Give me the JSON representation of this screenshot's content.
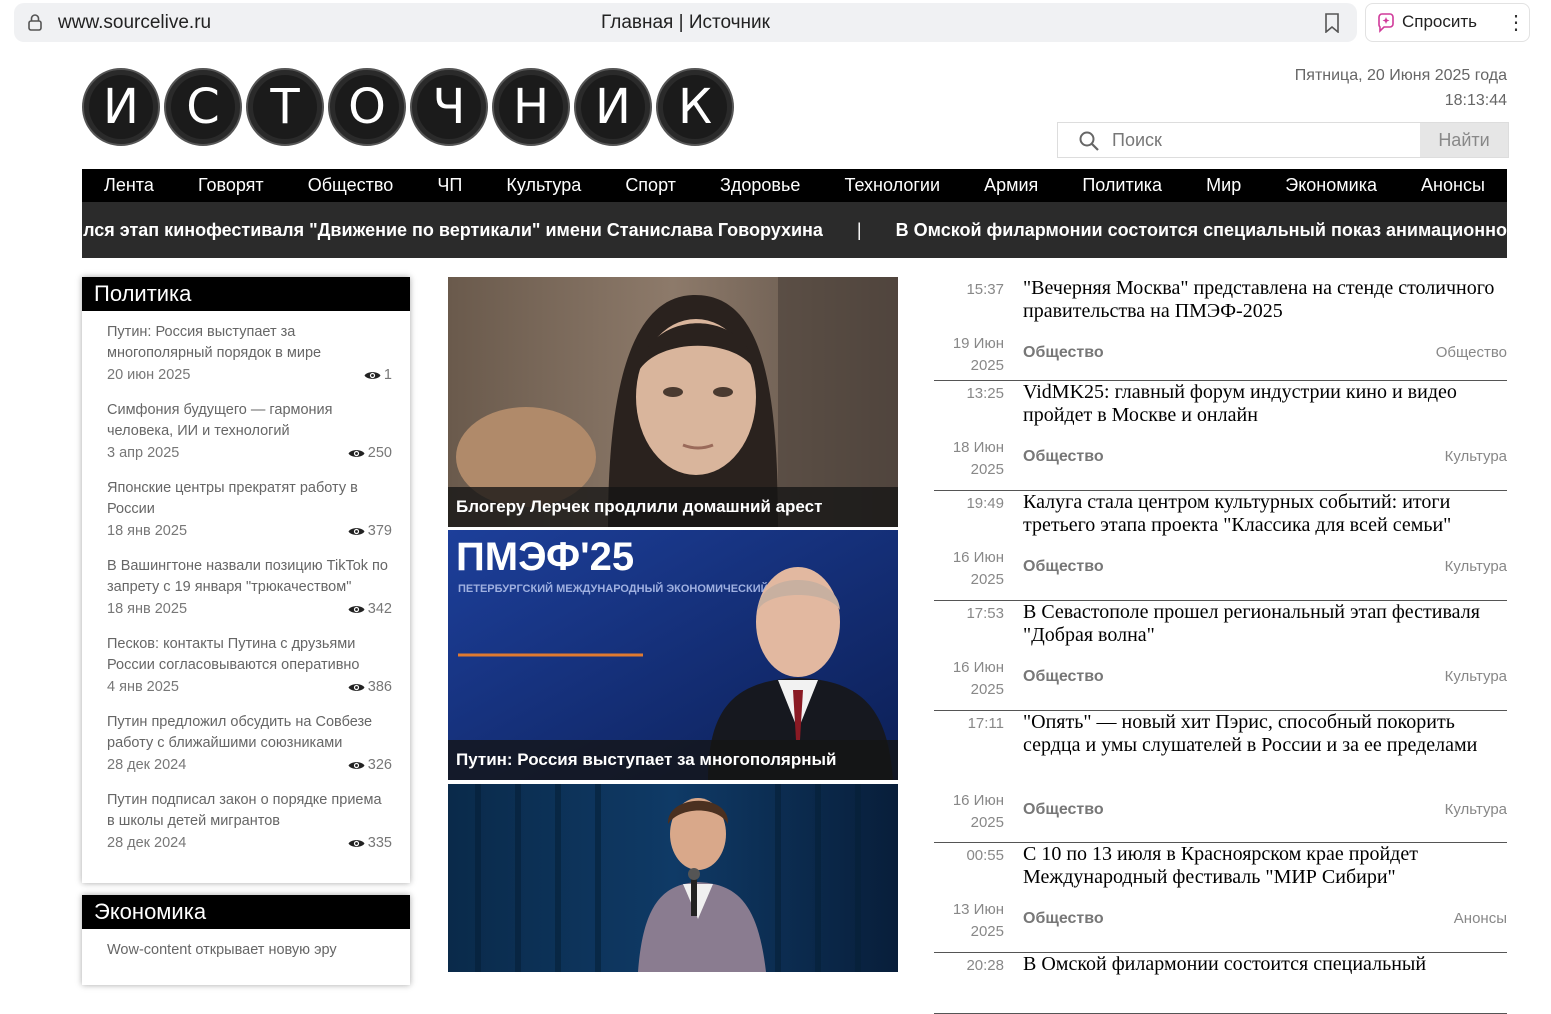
{
  "browser": {
    "url": "www.sourcelive.ru",
    "tab_title": "Главная | Источник",
    "ask_label": "Спросить"
  },
  "header": {
    "logo_letters": [
      "И",
      "С",
      "Т",
      "О",
      "Ч",
      "Н",
      "И",
      "К"
    ],
    "date": "Пятница, 20 Июня 2025 года",
    "time": "18:13:44",
    "search_placeholder": "Поиск",
    "search_button": "Найти"
  },
  "nav": [
    "Лента",
    "Говорят",
    "Общество",
    "ЧП",
    "Культура",
    "Спорт",
    "Здоровье",
    "Технологии",
    "Армия",
    "Политика",
    "Мир",
    "Экономика",
    "Анонсы"
  ],
  "ticker": {
    "item1": "ился этап кинофестиваля \"Движение по вертикали\" имени Станислава Говорухина",
    "separator": "|",
    "item2": "В Омской филармонии состоится специальный показ анимационного фильма \"Ай д"
  },
  "sidebar_politics": {
    "title": "Политика",
    "items": [
      {
        "title": "Путин: Россия выступает за многополярный порядок в мире",
        "date": "20 июн 2025",
        "views": "1"
      },
      {
        "title": "Симфония будущего — гармония человека, ИИ и технологий",
        "date": "3 апр 2025",
        "views": "250"
      },
      {
        "title": "Японские центры прекратят работу в России",
        "date": "18 янв 2025",
        "views": "379"
      },
      {
        "title": "В Вашингтоне назвали позицию TikTok по запрету с 19 января \"трюкачеством\"",
        "date": "18 янв 2025",
        "views": "342"
      },
      {
        "title": "Песков: контакты Путина с друзьями России согласовываются оперативно",
        "date": "4 янв 2025",
        "views": "386"
      },
      {
        "title": "Путин предложил обсудить на Совбезе работу с ближайшими союзниками",
        "date": "28 дек 2024",
        "views": "326"
      },
      {
        "title": "Путин подписал закон о порядке приема в школы детей мигрантов",
        "date": "28 дек 2024",
        "views": "335"
      }
    ]
  },
  "sidebar_economy": {
    "title": "Экономика",
    "first_item": "Wow-content открывает новую эру"
  },
  "cards": [
    {
      "caption": "Блогеру Лерчек продлили домашний арест"
    },
    {
      "caption": "Путин: Россия выступает за многополярный",
      "banner_big": "ПМЭФ'25",
      "banner_small": "ПЕТЕРБУРГСКИЙ МЕЖДУНАРОДНЫЙ ЭКОНОМИЧЕСКИЙ ФОРУМ"
    },
    {
      "caption": ""
    }
  ],
  "news": [
    {
      "time": "15:37",
      "title": "\"Вечерняя Москва\" представлена на стенде столичного правительства на ПМЭФ-2025",
      "day": "19 Июн",
      "year": "2025",
      "category": "Общество",
      "tag": "Общество"
    },
    {
      "time": "13:25",
      "title": "VidMK25: главный форум индустрии кино и видео пройдет в Москве и онлайн",
      "day": "18 Июн",
      "year": "2025",
      "category": "Общество",
      "tag": "Культура"
    },
    {
      "time": "19:49",
      "title": "Калуга стала центром культурных событий: итоги третьего этапа проекта \"Классика для всей семьи\"",
      "day": "16 Июн",
      "year": "2025",
      "category": "Общество",
      "tag": "Культура"
    },
    {
      "time": "17:53",
      "title": "В Севастополе прошел региональный этап фестиваля \"Добрая волна\"",
      "day": "16 Июн",
      "year": "2025",
      "category": "Общество",
      "tag": "Культура"
    },
    {
      "time": "17:11",
      "title": "\"Опять\" — новый хит Пэрис, способный покорить сердца и умы слушателей в России и за ее пределами",
      "day": "16 Июн",
      "year": "2025",
      "category": "Общество",
      "tag": "Культура"
    },
    {
      "time": "00:55",
      "title": "С 10 по 13 июля в Красноярском крае пройдет Международный фестиваль \"МИР Сибири\"",
      "day": "13 Июн",
      "year": "2025",
      "category": "Общество",
      "tag": "Анонсы"
    },
    {
      "time": "20:28",
      "title": "В Омской филармонии состоится специальный",
      "day": "",
      "year": "",
      "category": "",
      "tag": ""
    }
  ]
}
